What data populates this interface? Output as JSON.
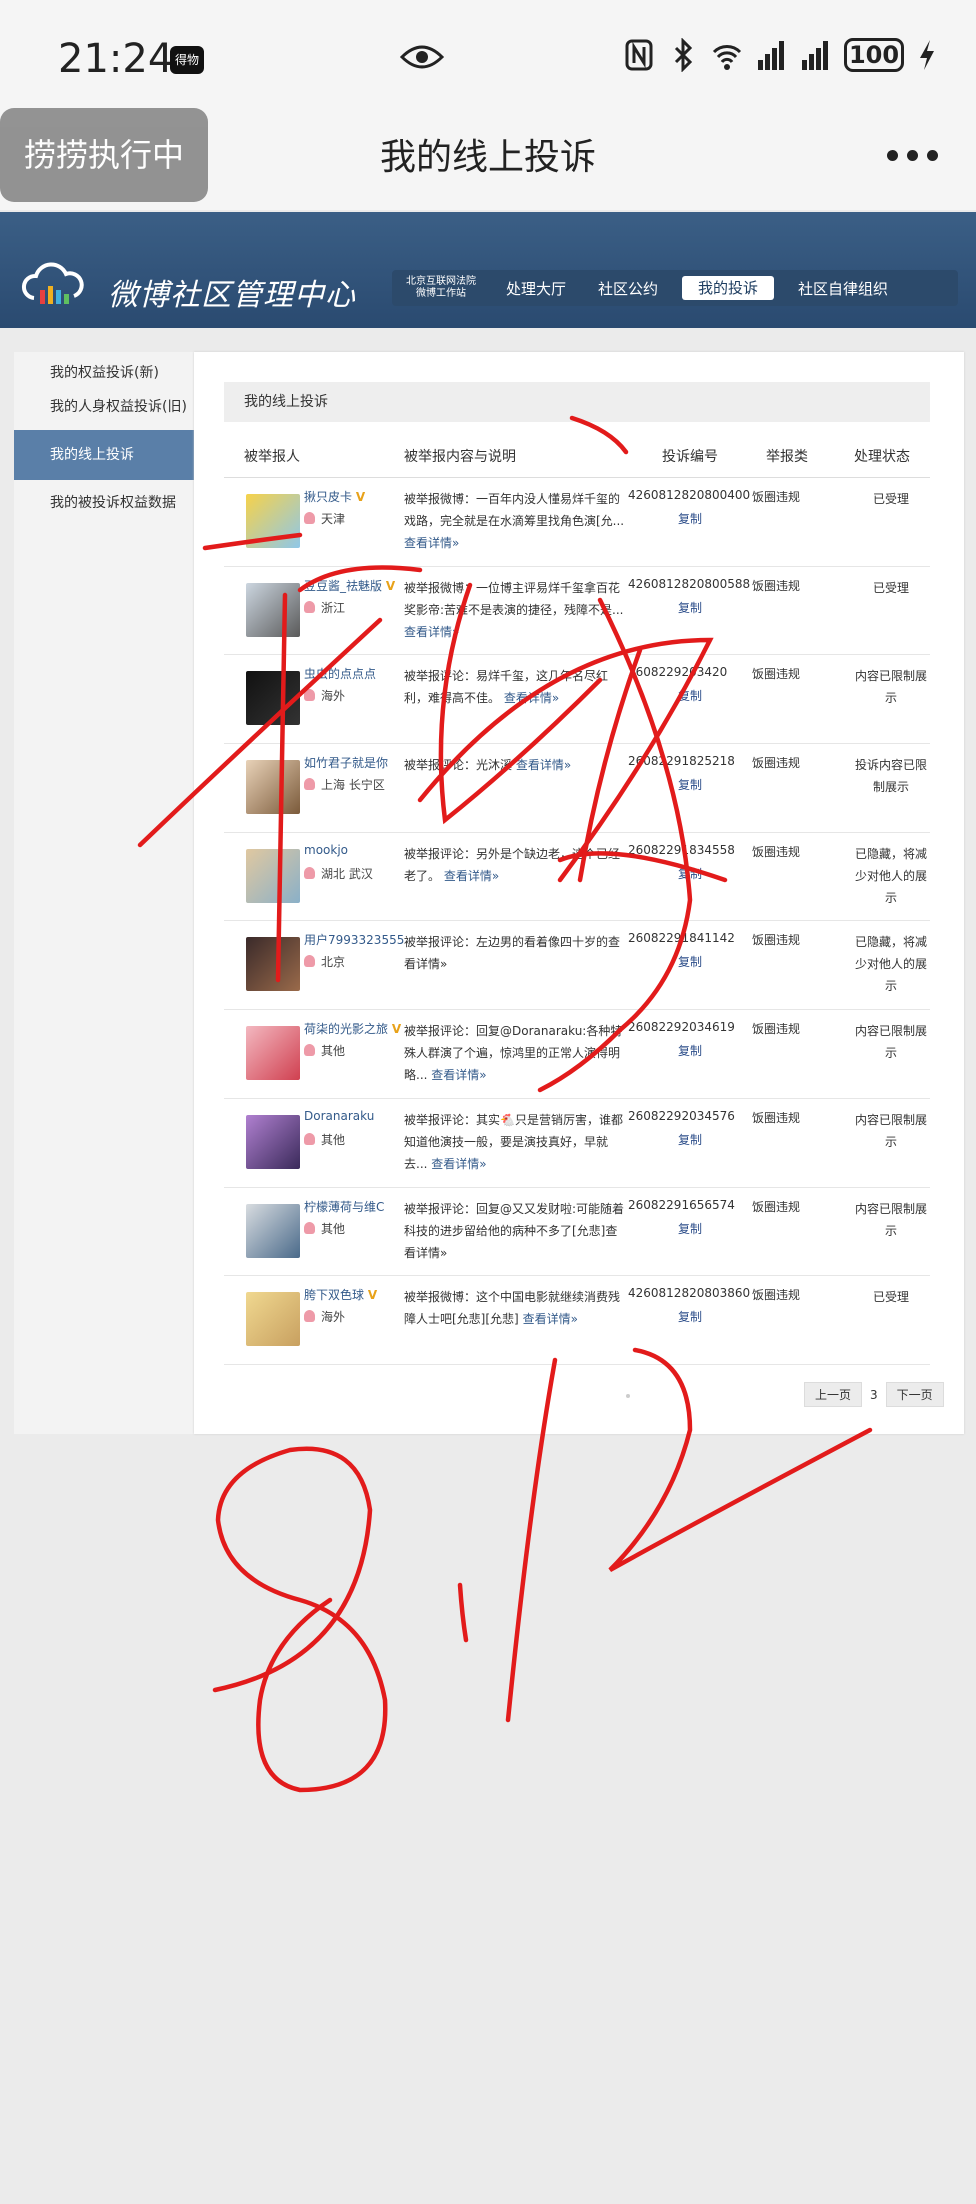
{
  "status_bar": {
    "time": "21:24",
    "app_badge": "得物",
    "battery": "100"
  },
  "title_bar": {
    "floating_button": "捞捞执行中",
    "title": "我的线上投诉"
  },
  "site": {
    "logo_text": "微博社区管理中心",
    "nav": [
      "北京互联网法院\n微博工作站",
      "处理大厅",
      "社区公约",
      "我的投诉",
      "社区自律组织"
    ],
    "nav_active": "我的投诉"
  },
  "sidebar": {
    "items": [
      "我的权益投诉(新)",
      "我的人身权益投诉(旧)",
      "我的线上投诉",
      "我的被投诉权益数据"
    ]
  },
  "main": {
    "breadcrumb": "我的线上投诉",
    "columns": [
      "被举报人",
      "被举报内容与说明",
      "投诉编号",
      "举报类",
      "处理状态"
    ],
    "copy_label": "复制",
    "rows": [
      {
        "user": "揪只皮卡",
        "verified": true,
        "location": "天津",
        "desc": "被举报微博：一百年内没人懂易烊千玺的戏路，完全就是在水滴筹里找角色演[允...",
        "more": "查看详情»",
        "no": "4260812820800400",
        "type": "饭圈违规",
        "status": "已受理",
        "avatar": [
          "#f6d24a",
          "#8fc7e8"
        ]
      },
      {
        "user": "豆豆酱_祛魅版",
        "verified": true,
        "location": "浙江",
        "desc": "被举报微博：一位博主评易烊千玺拿百花奖影帝:苦难不是表演的捷径，残障不是...",
        "more": "查看详情»",
        "no": "4260812820800588",
        "type": "饭圈违规",
        "status": "已受理",
        "avatar": [
          "#ccd6e0",
          "#5a5a5a"
        ]
      },
      {
        "user": "虫虫的点点点",
        "verified": false,
        "location": "海外",
        "desc": "被举报评论：易烊千玺，这几年名尽红利，难得高不佳。",
        "more": "查看详情»",
        "no": "2608229203420",
        "type": "饭圈违规",
        "status": "内容已限制展示",
        "avatar": [
          "#111111",
          "#333333"
        ]
      },
      {
        "user": "如竹君子就是你",
        "verified": false,
        "location": "上海 长宁区",
        "desc": "被举报评论：光沐溪",
        "more": "查看详情»",
        "no": "2608229182521​8",
        "type": "饭圈违规",
        "status": "投诉内容已限制展示",
        "avatar": [
          "#e8d2b8",
          "#7b5a3a"
        ]
      },
      {
        "user": "mookjo",
        "verified": false,
        "location": "湖北 武汉",
        "desc": "被举报评论：另外是个缺边老，这个已经老了。",
        "more": "查看详情»",
        "no": "26082291834558",
        "type": "饭圈违规",
        "status": "已隐藏，将减少对他人的展示",
        "avatar": [
          "#e0c8a0",
          "#8ab0c8"
        ]
      },
      {
        "user": "用户7993323555",
        "verified": false,
        "location": "北京",
        "desc": "被举报评论：左边男的看着像四十岁的查看详情»",
        "more": "",
        "no": "26082291841142",
        "type": "饭圈违规",
        "status": "已隐藏，将减少对他人的展示",
        "avatar": [
          "#3a2a2a",
          "#9a6a4a"
        ]
      },
      {
        "user": "荷柒的光影之旅",
        "verified": true,
        "location": "其他",
        "desc": "被举报评论：回复@Doranaraku:各种特殊人群演了个遍，惊鸿里的正常人演得明略...",
        "more": "查看详情»",
        "no": "26082292034619",
        "type": "饭圈违规",
        "status": "内容已限制展示",
        "avatar": [
          "#f3b8c0",
          "#d04050"
        ]
      },
      {
        "user": "Doranaraku",
        "verified": false,
        "location": "其他",
        "desc": "被举报评论：其实🐔只是营销厉害，谁都知道他演技一般，要是演技真好，早就去...",
        "more": "查看详情»",
        "no": "26082292034576",
        "type": "饭圈违规",
        "status": "内容已限制展示",
        "avatar": [
          "#b080d0",
          "#3a2a5a"
        ]
      },
      {
        "user": "柠檬薄荷与维C",
        "verified": false,
        "location": "其他",
        "desc": "被举报评论：回复@又又发财啦:可能随着科技的进步留给他的病种不多了[允悲]查看详情»",
        "more": "",
        "no": "26082291656574",
        "type": "饭圈违规",
        "status": "内容已限制展示",
        "avatar": [
          "#d8dce0",
          "#4a6a8a"
        ]
      },
      {
        "user": "胯下双色球",
        "verified": true,
        "location": "海外",
        "desc": "被举报微博：这个中国电影就继续消费残障人士吧[允悲][允悲]",
        "more": "查看详情»",
        "no": "4260812820803860",
        "type": "饭圈违规",
        "status": "已受理",
        "avatar": [
          "#f0d890",
          "#c8a060"
        ]
      }
    ],
    "pager": {
      "prev": "上一页",
      "page": "3",
      "next": "下一页"
    }
  },
  "annotation": {
    "handwriting": "8.12",
    "color": "#e21b1b"
  }
}
